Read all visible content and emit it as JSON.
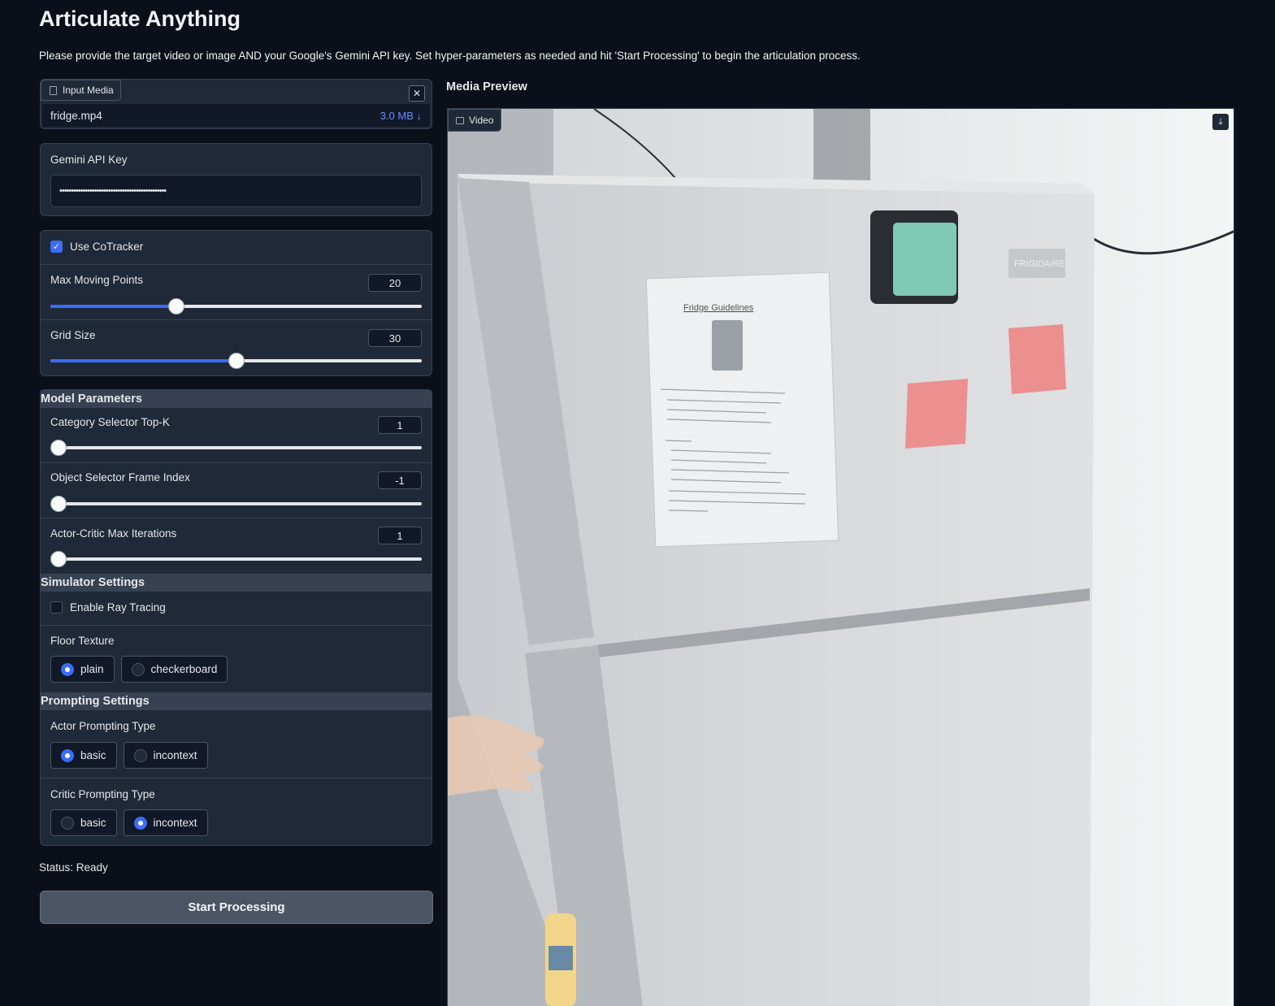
{
  "header": {
    "title": "Articulate Anything",
    "description": "Please provide the target video or image AND your Google's Gemini API key. Set hyper-parameters as needed and hit 'Start Processing' to begin the articulation process."
  },
  "input_media": {
    "label": "Input Media",
    "file_name": "fridge.mp4",
    "file_size": "3.0 MB ↓",
    "close_glyph": "✕"
  },
  "api_key": {
    "label": "Gemini API Key",
    "value": "••••••••••••••••••••••••••••••••••••••••••••••"
  },
  "cotracker": {
    "label": "Use CoTracker",
    "checked": true,
    "max_moving_points": {
      "label": "Max Moving Points",
      "value": "20",
      "fraction": 0.34
    },
    "grid_size": {
      "label": "Grid Size",
      "value": "30",
      "fraction": 0.5
    }
  },
  "model_parameters": {
    "heading": "Model Parameters",
    "category_top_k": {
      "label": "Category Selector Top-K",
      "value": "1",
      "fraction": 0.0
    },
    "frame_index": {
      "label": "Object Selector Frame Index",
      "value": "-1",
      "fraction": 0.0
    },
    "max_iterations": {
      "label": "Actor-Critic Max Iterations",
      "value": "1",
      "fraction": 0.0
    }
  },
  "simulator_settings": {
    "heading": "Simulator Settings",
    "ray_tracing_label": "Enable Ray Tracing",
    "ray_tracing_checked": false,
    "floor_texture": {
      "label": "Floor Texture",
      "options": [
        "plain",
        "checkerboard"
      ],
      "selected": "plain"
    }
  },
  "prompting_settings": {
    "heading": "Prompting Settings",
    "actor": {
      "label": "Actor Prompting Type",
      "options": [
        "basic",
        "incontext"
      ],
      "selected": "basic"
    },
    "critic": {
      "label": "Critic Prompting Type",
      "options": [
        "basic",
        "incontext"
      ],
      "selected": "incontext"
    }
  },
  "status": "Status: Ready",
  "start_button": "Start Processing",
  "preview": {
    "title": "Media Preview",
    "tag": "Video",
    "download_glyph": "⤓",
    "scene": {
      "note_title": "Fridge Guidelines",
      "brand": "FRIGIDAIRE",
      "colors": {
        "fridge": "#d4d6d9",
        "wall": "#eef0f1",
        "sticky": "#ec8686",
        "clip": "#7fc9b5"
      }
    }
  },
  "colors": {
    "background": "#0b0f19",
    "panel": "#1f2937",
    "accent": "#3b6cf6",
    "button": "#4b5563"
  }
}
